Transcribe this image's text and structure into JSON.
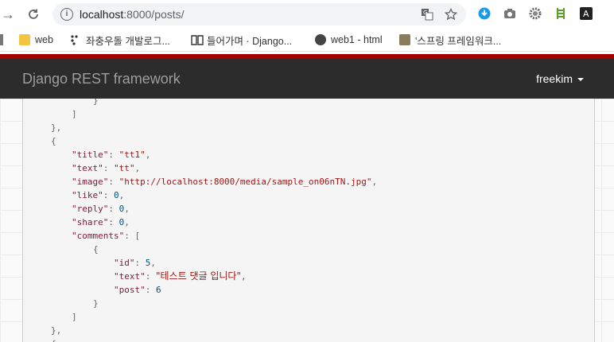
{
  "browser": {
    "url_host": "localhost",
    "url_rest": ":8000/posts/",
    "nav": {
      "back": "←",
      "forward": "→",
      "reload": "⟳"
    }
  },
  "bookmarks": [
    {
      "label": "web",
      "icon": "folder-icon"
    },
    {
      "label": "좌충우돌 개발로그...",
      "icon": "dots-icon"
    },
    {
      "label": "들어가며 · Django...",
      "icon": "book-icon"
    },
    {
      "label": "web1 - html",
      "icon": "globe-icon"
    },
    {
      "label": "'스프링 프레임워크...",
      "icon": "avatar-icon"
    }
  ],
  "drf": {
    "brand": "Django REST framework",
    "user": "freekim"
  },
  "json_lines": [
    {
      "t": "}"
    },
    {
      "t": "]"
    },
    {
      "t": "},"
    },
    {
      "t": "{"
    },
    {
      "key": "\"title\"",
      "val": "\"tt1\"",
      "vt": "s",
      "end": ","
    },
    {
      "key": "\"text\"",
      "val": "\"tt\"",
      "vt": "s",
      "end": ","
    },
    {
      "key": "\"image\"",
      "val": "\"http://localhost:8000/media/sample_on06nTN.jpg\"",
      "vt": "s",
      "end": ","
    },
    {
      "key": "\"like\"",
      "val": "0",
      "vt": "n",
      "end": ","
    },
    {
      "key": "\"reply\"",
      "val": "0",
      "vt": "n",
      "end": ","
    },
    {
      "key": "\"share\"",
      "val": "0",
      "vt": "n",
      "end": ","
    },
    {
      "key": "\"comments\"",
      "val": "[",
      "vt": "p",
      "end": ""
    },
    {
      "t": "{"
    },
    {
      "key": "\"id\"",
      "val": "5",
      "vt": "n",
      "end": ","
    },
    {
      "key": "\"text\"",
      "val": "\"테스트 댓글 입니다\"",
      "vt": "s",
      "end": ","
    },
    {
      "key": "\"post\"",
      "val": "6",
      "vt": "n",
      "end": ""
    },
    {
      "t": "}"
    },
    {
      "t": "]"
    },
    {
      "t": "},"
    },
    {
      "t": "{"
    }
  ],
  "colors": {
    "header_bg": "#2c2c2c",
    "accent_red": "#a30000"
  }
}
